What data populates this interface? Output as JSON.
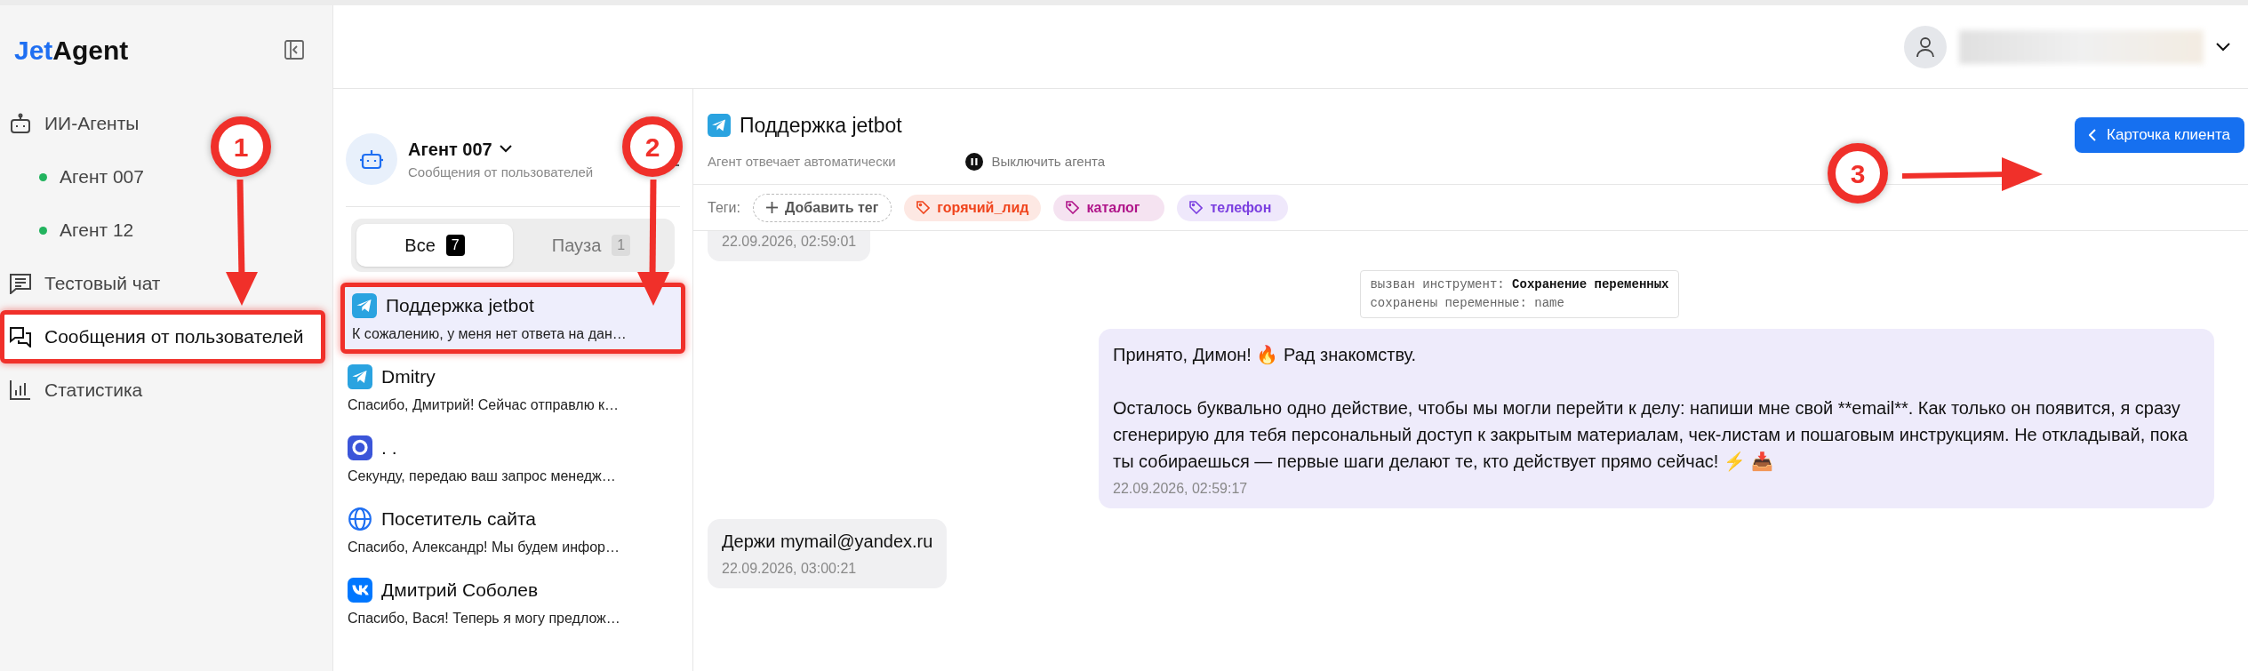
{
  "logo": {
    "part_1": "Jet",
    "part_2": "Agent"
  },
  "sidebar": {
    "items": [
      {
        "kind": "section",
        "label": "ИИ-Агенты",
        "selected": false,
        "highlighted": false
      },
      {
        "kind": "agent",
        "label": "Агент 007",
        "selected": false,
        "highlighted": false,
        "color": "#22b35e"
      },
      {
        "kind": "agent",
        "label": "Агент 12",
        "selected": false,
        "highlighted": false,
        "color": "#22b35e"
      },
      {
        "kind": "section",
        "label": "Тестовый чат",
        "selected": false,
        "highlighted": false
      },
      {
        "kind": "section",
        "label": "Сообщения от пользователей",
        "selected": true,
        "highlighted": true
      },
      {
        "kind": "section",
        "label": "Статистика",
        "selected": false,
        "highlighted": false
      }
    ]
  },
  "chat_list": {
    "agent_name": "Агент 007",
    "subtitle": "Сообщения от пользователей",
    "tabs": [
      {
        "label": "Все",
        "count": "7",
        "selected": true
      },
      {
        "label": "Пауза",
        "count": "1",
        "selected": false
      }
    ],
    "items": [
      {
        "kind": "telegram",
        "name": "Поддержка jetbot",
        "preview": "К сожалению, у меня нет ответа на дан…",
        "selected": true,
        "highlighted": true
      },
      {
        "kind": "telegram",
        "name": "Dmitry",
        "preview": "Спасибо, Дмитрий! Сейчас отправлю к…",
        "selected": false,
        "highlighted": false
      },
      {
        "kind": "max",
        "name": ". .",
        "preview": "Секунду, передаю ваш запрос менедж…",
        "selected": false,
        "highlighted": false
      },
      {
        "kind": "web",
        "name": "Посетитель сайта",
        "preview": "Спасибо, Александр! Мы будем инфор…",
        "selected": false,
        "highlighted": false
      },
      {
        "kind": "vk",
        "name": "Дмитрий Соболев",
        "preview": "Спасибо, Вася! Теперь я могу предлож…",
        "selected": false,
        "highlighted": false
      }
    ]
  },
  "chat": {
    "title": "Поддержка jetbot",
    "status": "Агент отвечает автоматически",
    "pause_button": "Выключить агента",
    "client_card_button": "Карточка клиента",
    "tags_label": "Теги:",
    "add_tag_button": "Добавить тег",
    "tags": [
      {
        "label": "горячий_лид",
        "color": "#f0441c"
      },
      {
        "label": "каталог",
        "color": "#b0158a"
      },
      {
        "label": "телефон",
        "color": "#7b3fe0"
      }
    ],
    "messages": [
      {
        "kind": "incoming",
        "time": "22.09.2026, 02:59:01"
      },
      {
        "kind": "tool",
        "lines": [
          "вызван инструмент: **Сохранение переменных**",
          "сохранены переменные: name"
        ]
      },
      {
        "kind": "outgoing",
        "paragraphs": [
          "Принято, Димон! 🔥 Рад знакомству.",
          "Осталось буквально одно действие, чтобы мы могли перейти к делу: напиши мне свой **email**. Как только он появится, я сразу сгенерирую для тебя персональный доступ к закрытым материалам, чек-листам и пошаговым инструкциям. Не откладывай, пока ты собираешься — первые шаги делают те, кто действует прямо сейчас! ⚡ 📥"
        ],
        "time": "22.09.2026, 02:59:17"
      },
      {
        "kind": "incoming",
        "text": "Держи mymail@yandex.ru",
        "time": "22.09.2026, 03:00:21"
      }
    ]
  },
  "annotations": [
    {
      "label": "1"
    },
    {
      "label": "2"
    },
    {
      "label": "3"
    }
  ]
}
